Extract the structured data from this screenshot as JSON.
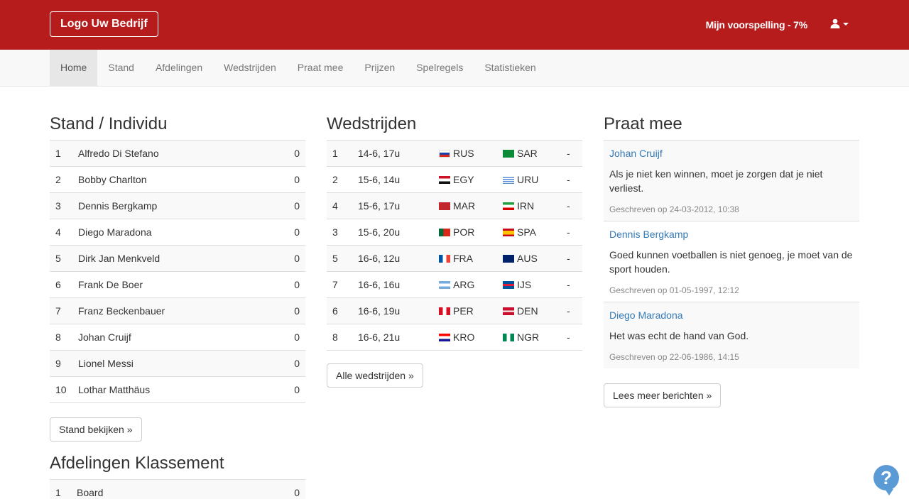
{
  "header": {
    "logo_label": "Logo Uw Bedrijf",
    "prediction_label": "Mijn voorspelling - 7%",
    "user_icon": "user-icon"
  },
  "nav": {
    "items": [
      "Home",
      "Stand",
      "Afdelingen",
      "Wedstrijden",
      "Praat mee",
      "Prijzen",
      "Spelregels",
      "Statistieken"
    ],
    "active": "Home"
  },
  "standings": {
    "title": "Stand / Individu",
    "rows": [
      {
        "rank": "1",
        "name": "Alfredo Di Stefano",
        "points": "0"
      },
      {
        "rank": "2",
        "name": "Bobby Charlton",
        "points": "0"
      },
      {
        "rank": "3",
        "name": "Dennis Bergkamp",
        "points": "0"
      },
      {
        "rank": "4",
        "name": "Diego Maradona",
        "points": "0"
      },
      {
        "rank": "5",
        "name": "Dirk Jan Menkveld",
        "points": "0"
      },
      {
        "rank": "6",
        "name": "Frank De Boer",
        "points": "0"
      },
      {
        "rank": "7",
        "name": "Franz Beckenbauer",
        "points": "0"
      },
      {
        "rank": "8",
        "name": "Johan Cruijf",
        "points": "0"
      },
      {
        "rank": "9",
        "name": "Lionel Messi",
        "points": "0"
      },
      {
        "rank": "10",
        "name": "Lothar Matthäus",
        "points": "0"
      }
    ],
    "button_label": "Stand bekijken »"
  },
  "departments": {
    "title": "Afdelingen Klassement",
    "rows": [
      {
        "rank": "1",
        "name": "Board",
        "points": "0"
      }
    ]
  },
  "matches": {
    "title": "Wedstrijden",
    "rows": [
      {
        "no": "1",
        "date": "14-6, 17u",
        "home": "RUS",
        "away": "SAR",
        "score": "-"
      },
      {
        "no": "2",
        "date": "15-6, 14u",
        "home": "EGY",
        "away": "URU",
        "score": "-"
      },
      {
        "no": "4",
        "date": "15-6, 17u",
        "home": "MAR",
        "away": "IRN",
        "score": "-"
      },
      {
        "no": "3",
        "date": "15-6, 20u",
        "home": "POR",
        "away": "SPA",
        "score": "-"
      },
      {
        "no": "5",
        "date": "16-6, 12u",
        "home": "FRA",
        "away": "AUS",
        "score": "-"
      },
      {
        "no": "7",
        "date": "16-6, 16u",
        "home": "ARG",
        "away": "IJS",
        "score": "-"
      },
      {
        "no": "6",
        "date": "16-6, 19u",
        "home": "PER",
        "away": "DEN",
        "score": "-"
      },
      {
        "no": "8",
        "date": "16-6, 21u",
        "home": "KRO",
        "away": "NGR",
        "score": "-"
      }
    ],
    "button_label": "Alle wedstrijden »"
  },
  "chat": {
    "title": "Praat mee",
    "posts": [
      {
        "author": "Johan Cruijf",
        "text": "Als je niet ken winnen, moet je zorgen dat je niet verliest.",
        "meta": "Geschreven op 24-03-2012, 10:38"
      },
      {
        "author": "Dennis Bergkamp",
        "text": "Goed kunnen voetballen is niet genoeg, je moet van de sport houden.",
        "meta": "Geschreven op 01-05-1997, 12:12"
      },
      {
        "author": "Diego Maradona",
        "text": "Het was echt de hand van God.",
        "meta": "Geschreven op 22-06-1986, 14:15"
      }
    ],
    "button_label": "Lees meer berichten »"
  },
  "colors": {
    "brand": "#b71c1c",
    "link": "#337ab7",
    "help": "#5b9bd5"
  },
  "help_icon": "help-icon"
}
